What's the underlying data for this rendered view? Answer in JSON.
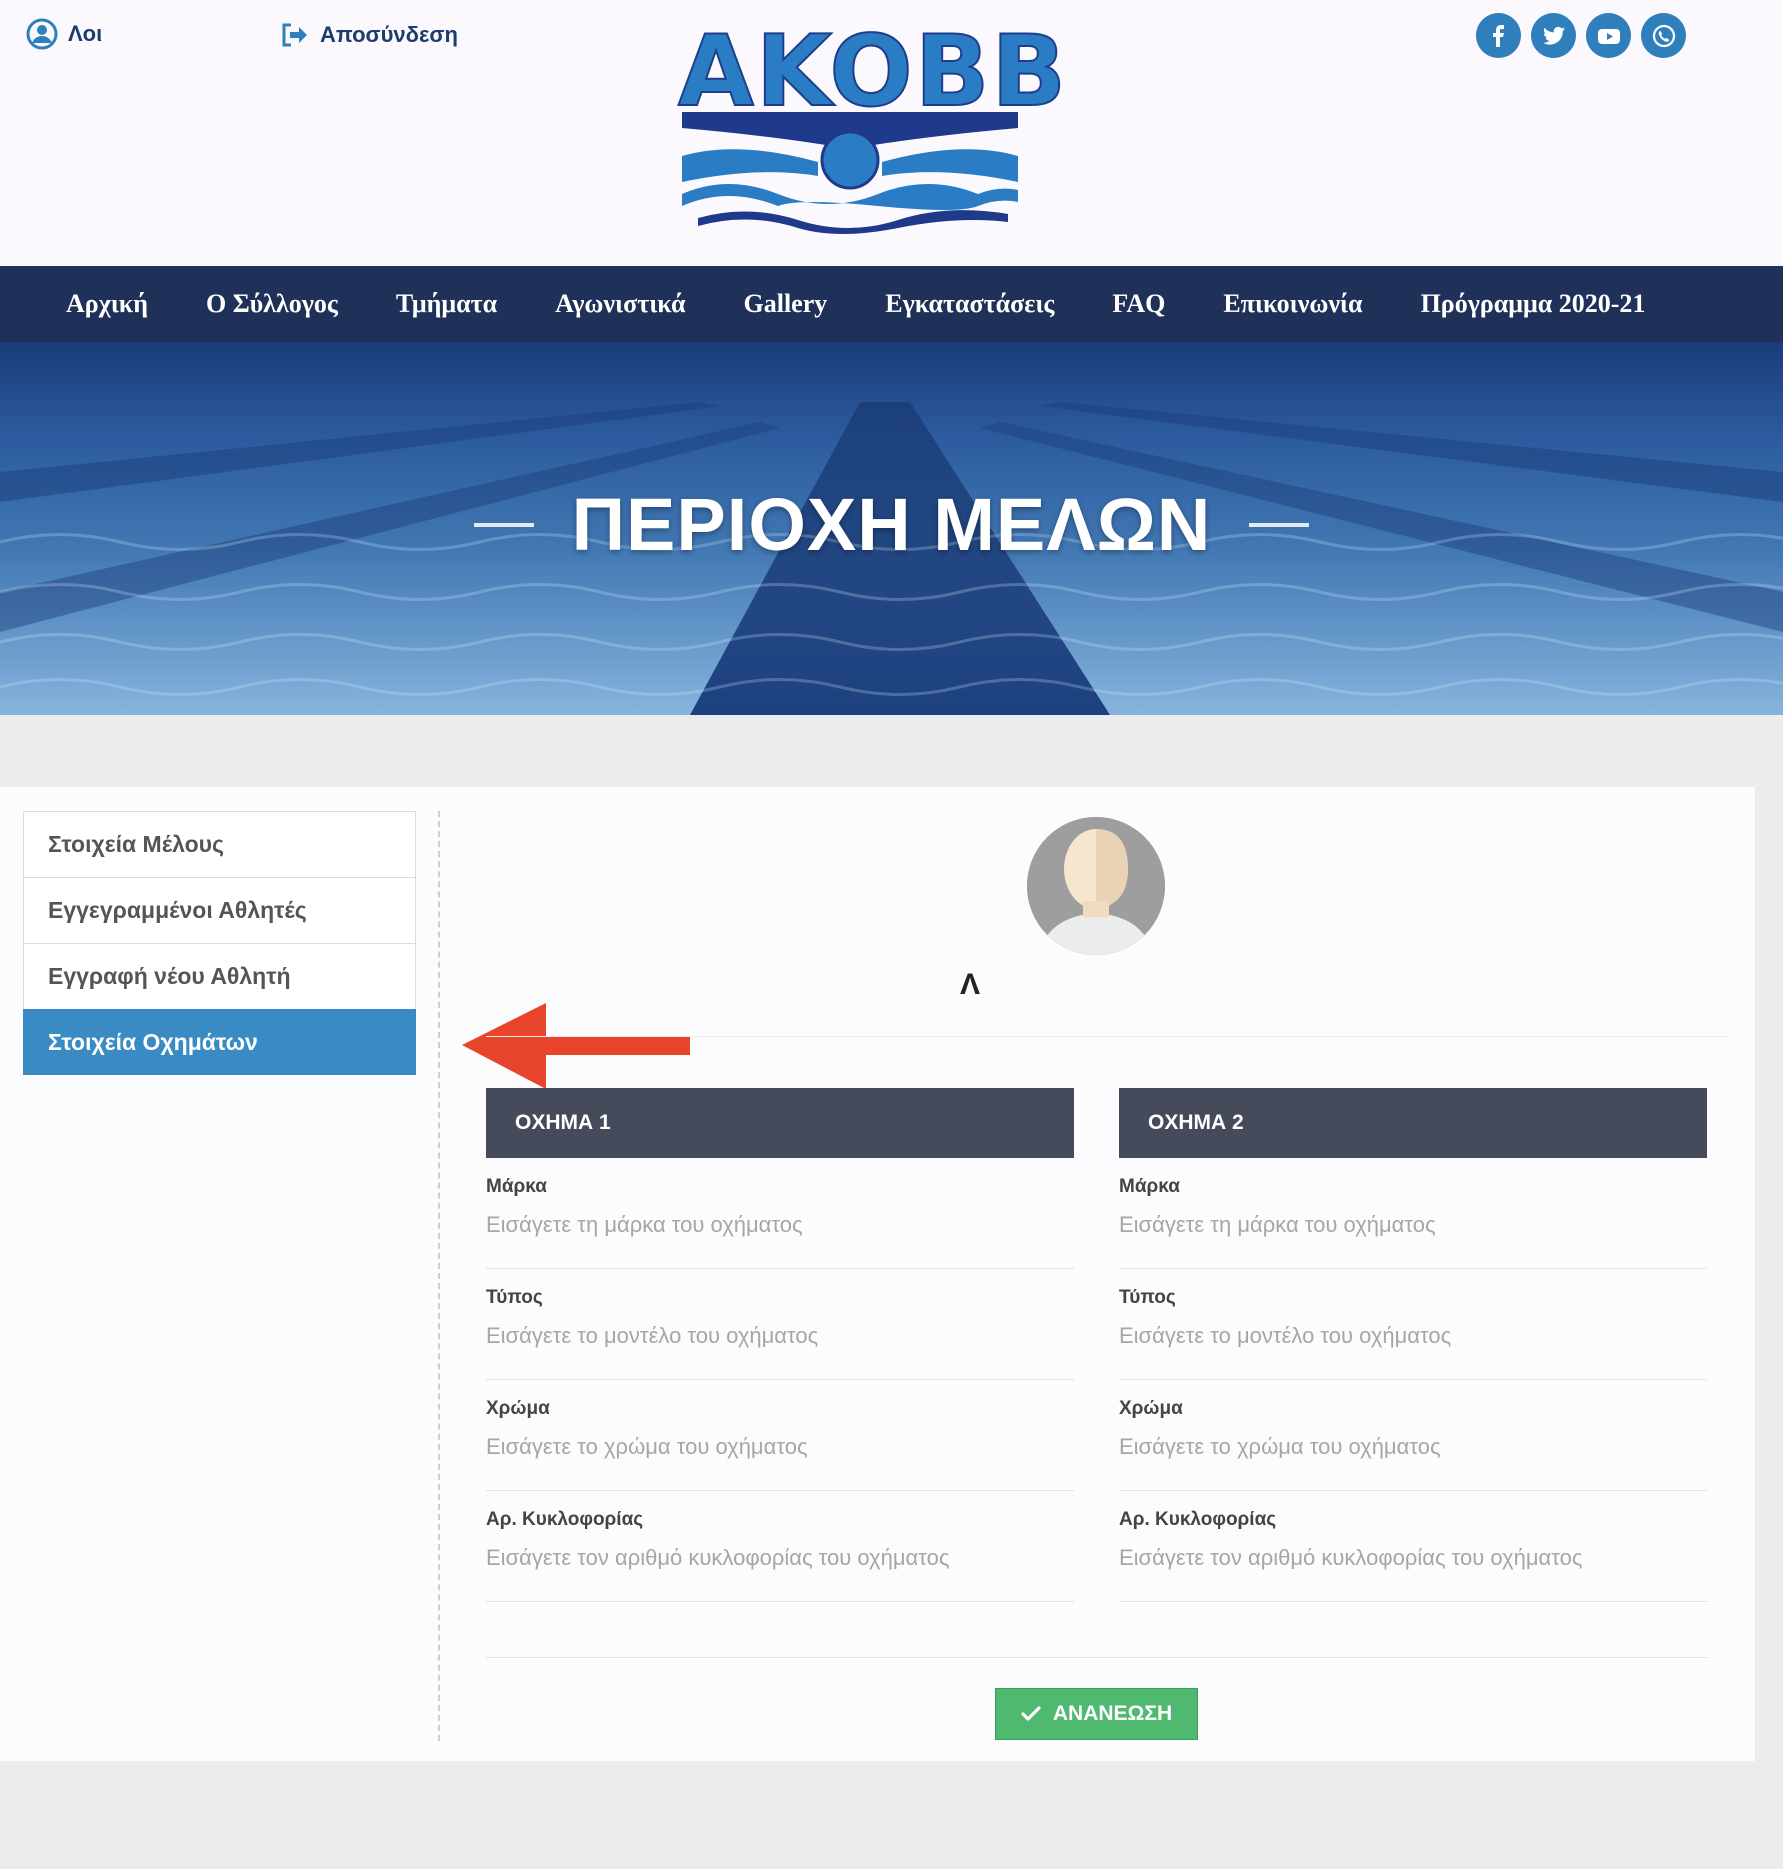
{
  "header": {
    "user_label": "Λοι",
    "logout_label": "Αποσύνδεση",
    "logo_text": "AKOBB",
    "socials": [
      "facebook-icon",
      "twitter-icon",
      "youtube-icon",
      "viber-icon"
    ],
    "brand_color": "#2a7cc4"
  },
  "nav": {
    "items": [
      "Αρχική",
      "Ο Σύλλογος",
      "Τμήματα",
      "Αγωνιστικά",
      "Gallery",
      "Εγκαταστάσεις",
      "FAQ",
      "Επικοινωνία",
      "Πρόγραμμα 2020-21"
    ]
  },
  "hero": {
    "title": "ΠΕΡΙΟΧΗ ΜΕΛΩΝ"
  },
  "sidebar": {
    "items": [
      {
        "label": "Στοιχεία Μέλους",
        "active": false
      },
      {
        "label": "Εγγεγραμμένοι Αθλητές",
        "active": false
      },
      {
        "label": "Εγγραφή νέου Αθλητή",
        "active": false
      },
      {
        "label": "Στοιχεία Οχημάτων",
        "active": true
      }
    ]
  },
  "profile": {
    "name_initial": "Λ"
  },
  "vehicles": [
    {
      "title": "ΟΧΗΜΑ 1",
      "fields": [
        {
          "label": "Μάρκα",
          "placeholder": "Εισάγετε τη μάρκα του οχήματος",
          "value": ""
        },
        {
          "label": "Τύπος",
          "placeholder": "Εισάγετε το μοντέλο του οχήματος",
          "value": ""
        },
        {
          "label": "Χρώμα",
          "placeholder": "Εισάγετε το χρώμα του οχήματος",
          "value": ""
        },
        {
          "label": "Αρ. Κυκλοφορίας",
          "placeholder": "Εισάγετε τον αριθμό κυκλοφορίας του οχήματος",
          "value": ""
        }
      ]
    },
    {
      "title": "ΟΧΗΜΑ 2",
      "fields": [
        {
          "label": "Μάρκα",
          "placeholder": "Εισάγετε τη μάρκα του οχήματος",
          "value": ""
        },
        {
          "label": "Τύπος",
          "placeholder": "Εισάγετε το μοντέλο του οχήματος",
          "value": ""
        },
        {
          "label": "Χρώμα",
          "placeholder": "Εισάγετε το χρώμα του οχήματος",
          "value": ""
        },
        {
          "label": "Αρ. Κυκλοφορίας",
          "placeholder": "Εισάγετε τον αριθμό κυκλοφορίας του οχήματος",
          "value": ""
        }
      ]
    }
  ],
  "actions": {
    "update_label": "ΑΝΑΝΕΩΣΗ",
    "update_color": "#4fba6f"
  },
  "annotation": {
    "arrow_color": "#e8442c"
  }
}
